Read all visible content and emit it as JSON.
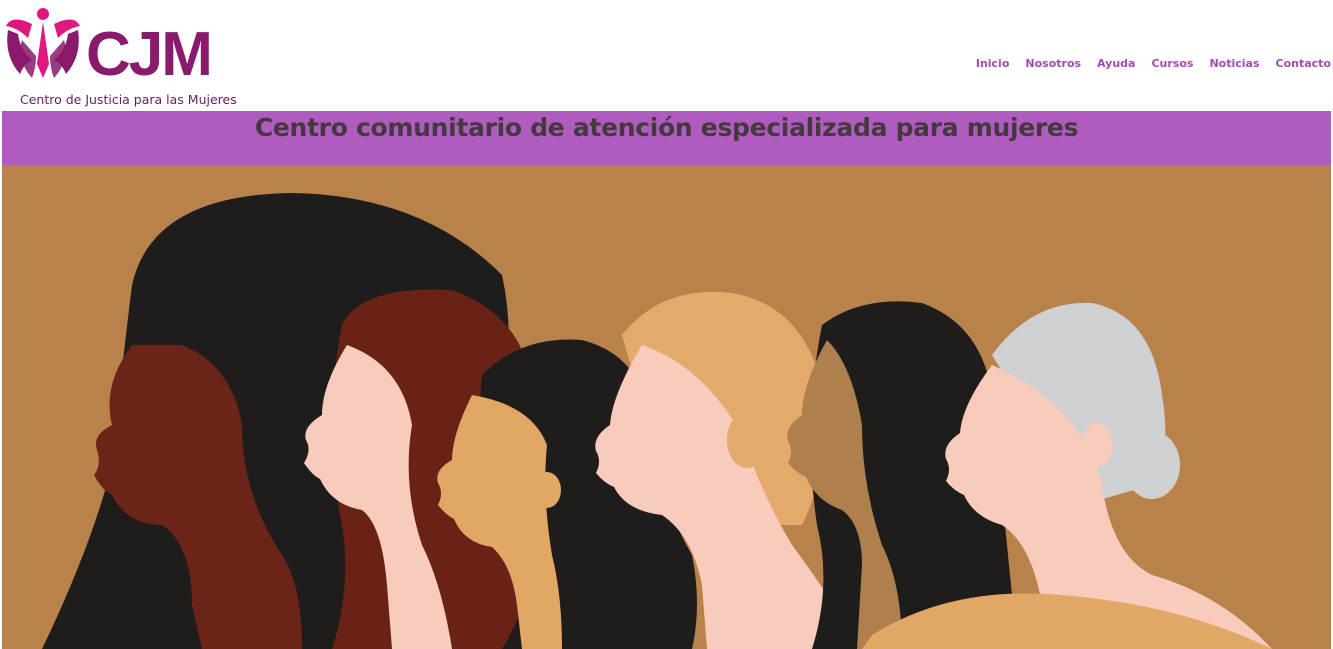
{
  "header": {
    "logo": {
      "letters": "CJM",
      "tagline": "Centro de Justicia para las Mujeres"
    },
    "nav": [
      "Inicio",
      "Nosotros",
      "Ayuda",
      "Cursos",
      "Noticias",
      "Contacto"
    ]
  },
  "banner": {
    "title": "Centro comunitario de atención especializada para mujeres"
  },
  "colors": {
    "brand": "#8a1a6c",
    "nav_link": "#a24bb3",
    "banner_bg": "#b05bbf",
    "hero_bg": "#b9824b"
  }
}
